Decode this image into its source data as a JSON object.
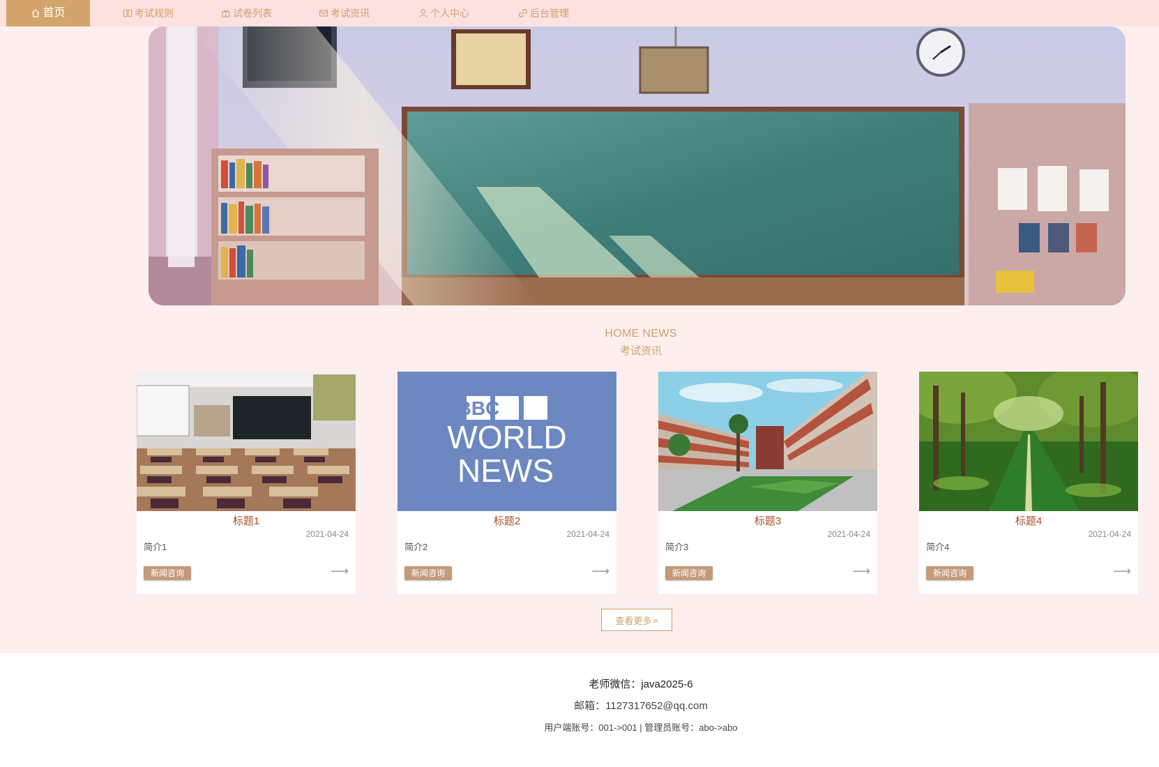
{
  "nav": {
    "items": [
      {
        "label": "首页",
        "icon": "home-icon",
        "active": true
      },
      {
        "label": "考试规则",
        "icon": "book-icon",
        "active": false
      },
      {
        "label": "试卷列表",
        "icon": "gift-icon",
        "active": false
      },
      {
        "label": "考试资讯",
        "icon": "mail-icon",
        "active": false
      },
      {
        "label": "个人中心",
        "icon": "user-icon",
        "active": false
      },
      {
        "label": "后台管理",
        "icon": "link-icon",
        "active": false
      }
    ]
  },
  "section": {
    "title_en": "HOME NEWS",
    "title_cn": "考试资讯"
  },
  "cards": [
    {
      "title": "标题1",
      "date": "2021-04-24",
      "intro": "简介1",
      "tag": "新闻咨询",
      "image": "classroom"
    },
    {
      "title": "标题2",
      "date": "2021-04-24",
      "intro": "简介2",
      "tag": "新闻咨询",
      "image": "bbc-world-news",
      "image_text": {
        "line1": "BBC",
        "line2": "WORLD",
        "line3": "NEWS"
      }
    },
    {
      "title": "标题3",
      "date": "2021-04-24",
      "intro": "简介3",
      "tag": "新闻咨询",
      "image": "campus-building"
    },
    {
      "title": "标题4",
      "date": "2021-04-24",
      "intro": "简介4",
      "tag": "新闻咨询",
      "image": "tree-lined-road"
    }
  ],
  "more_button": "查看更多",
  "footer": {
    "wechat": "老师微信：java2025-6",
    "email": "邮箱：1127317652@qq.com",
    "accounts": "用户端账号：001->001 | 管理员账号：abo->abo"
  },
  "colors": {
    "accent": "#cfa16b",
    "nav_bg": "#fde1e1",
    "page_bg": "#fdefee",
    "tag_bg": "#c49a7a",
    "title_color": "#a0522d"
  }
}
